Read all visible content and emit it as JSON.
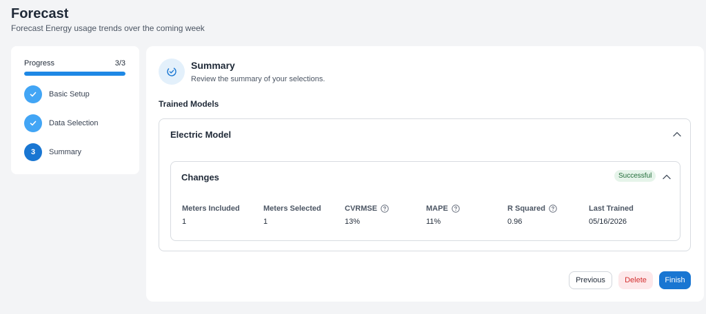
{
  "header": {
    "title": "Forecast",
    "subtitle": "Forecast Energy usage trends over the coming week"
  },
  "progress": {
    "label": "Progress",
    "count": "3/3",
    "fraction": 1.0,
    "steps": [
      {
        "number": "1",
        "label": "Basic Setup",
        "state": "done",
        "icon": "check-icon"
      },
      {
        "number": "2",
        "label": "Data Selection",
        "state": "done",
        "icon": "check-icon"
      },
      {
        "number": "3",
        "label": "Summary",
        "state": "active"
      }
    ]
  },
  "summary": {
    "icon": "check-circle-icon",
    "title": "Summary",
    "description": "Review the summary of your selections.",
    "section_title": "Trained Models",
    "model": {
      "name": "Electric Model",
      "changes": {
        "title": "Changes",
        "status": "Successful",
        "metrics": [
          {
            "label": "Meters Included",
            "value": "1",
            "help": false
          },
          {
            "label": "Meters Selected",
            "value": "1",
            "help": false
          },
          {
            "label": "CVRMSE",
            "value": "13%",
            "help": true
          },
          {
            "label": "MAPE",
            "value": "11%",
            "help": true
          },
          {
            "label": "R Squared",
            "value": "0.96",
            "help": true
          },
          {
            "label": "Last Trained",
            "value": "05/16/2026",
            "help": false
          }
        ]
      }
    }
  },
  "actions": {
    "previous": "Previous",
    "delete": "Delete",
    "finish": "Finish"
  },
  "colors": {
    "accent": "#1976d2",
    "step_done": "#42a5f5",
    "delete_text": "#d32f2f",
    "success_bg": "#e6f4ea"
  }
}
